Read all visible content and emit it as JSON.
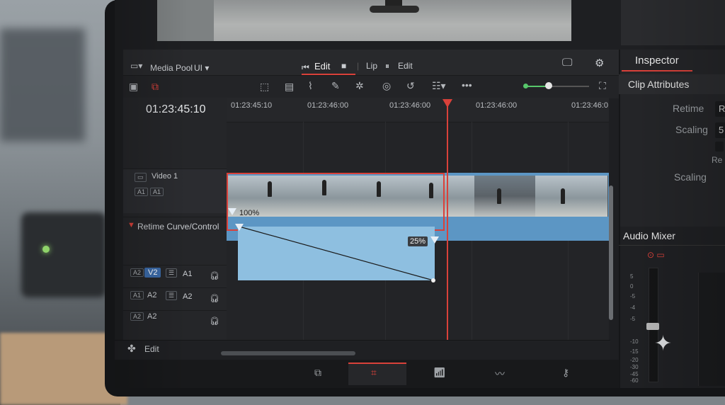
{
  "toolbar": {
    "media_pool": "Media Pool",
    "ui_label": "UI",
    "edit_active": "Edit",
    "clip_label": "Lip",
    "edit_secondary": "Edit"
  },
  "timeline": {
    "timecode": "01:23:45:10",
    "ruler": [
      "01:23:45:10",
      "01:23:46:00",
      "01:23:46:00",
      "01:23:46:00",
      "01:23:46:0"
    ],
    "video_track": "Video 1",
    "video_badge1": "A1",
    "video_badge2": "A1",
    "retime_track": "Retime Curve/Control",
    "speed_start": "100%",
    "speed_end": "25%",
    "audio_tracks": [
      {
        "badge": "A2",
        "name": "V2",
        "link": "A1"
      },
      {
        "badge": "A1",
        "name": "A2",
        "link": "A2"
      },
      {
        "badge": "A2",
        "name": "A2",
        "link": ""
      }
    ],
    "footer_label": "Edit"
  },
  "inspector": {
    "tab": "Inspector",
    "section": "Clip Attributes",
    "props": [
      {
        "label": "Retime",
        "value": "R"
      },
      {
        "label": "Scaling",
        "value": "5"
      },
      {
        "label": "Scaling",
        "value": ""
      }
    ],
    "extra_label": "Re"
  },
  "mixer": {
    "title": "Audio Mixer",
    "db_marks": [
      "5",
      "0",
      "-5",
      "-4",
      "-5",
      "-10",
      "-15",
      "-20",
      "-30",
      "-45",
      "-60"
    ]
  },
  "colors": {
    "accent": "#d9413a",
    "clip_blue": "#5c96c4",
    "slider_green": "#57c76b"
  }
}
